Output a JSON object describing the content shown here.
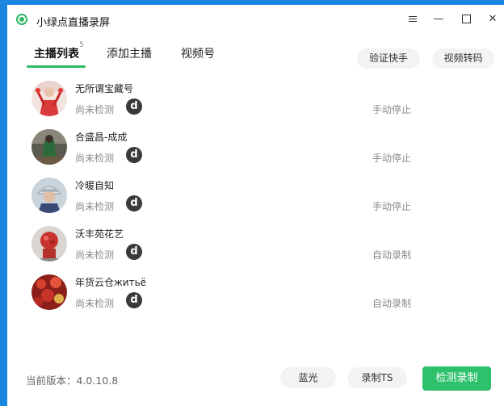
{
  "app": {
    "title": "小绿点直播录屏",
    "accent_color": "#2fb866"
  },
  "tabs": [
    {
      "label": "主播列表",
      "badge": "5",
      "active": true
    },
    {
      "label": "添加主播",
      "active": false
    },
    {
      "label": "视频号",
      "active": false
    }
  ],
  "top_actions": {
    "verify_kuaishou": "验证快手",
    "video_transcode": "视频转码"
  },
  "streamers": [
    {
      "name": "无所谓宝藏号",
      "status": "尚未检测",
      "platform_icon": "d",
      "mode": "手动停止"
    },
    {
      "name": "合盛昌-成成",
      "status": "尚未检测",
      "platform_icon": "d",
      "mode": "手动停止"
    },
    {
      "name": "冷暖自知",
      "status": "尚未检测",
      "platform_icon": "d",
      "mode": "手动停止"
    },
    {
      "name": "沃丰苑花艺",
      "status": "尚未检测",
      "platform_icon": "d",
      "mode": "自动录制"
    },
    {
      "name": "年货云仓житьё",
      "status": "尚未检测",
      "platform_icon": "d",
      "mode": "自动录制"
    }
  ],
  "footer": {
    "version": "当前版本：4.0.10.8",
    "bluray_label": "蓝光",
    "record_ts_label": "录制TS",
    "detect_record_label": "检测录制"
  }
}
